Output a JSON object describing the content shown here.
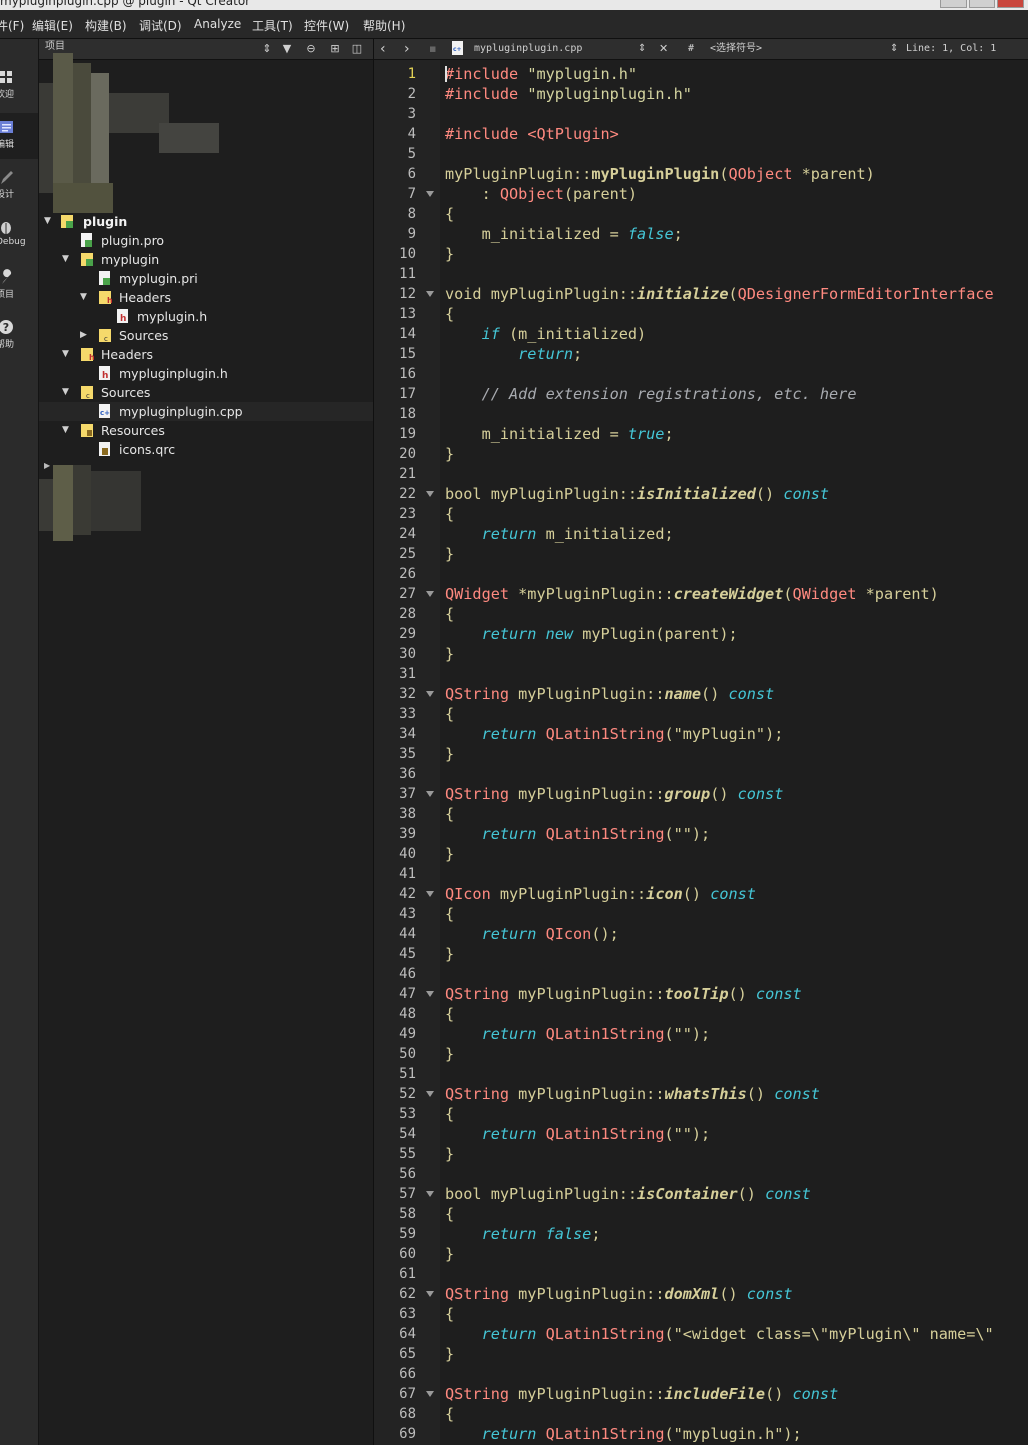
{
  "window": {
    "title": "mypluginplugin.cpp @ plugin - Qt Creator"
  },
  "menu": [
    {
      "id": "file",
      "label": "件(F)"
    },
    {
      "id": "edit",
      "label": "编辑(E)"
    },
    {
      "id": "build",
      "label": "构建(B)"
    },
    {
      "id": "debug",
      "label": "调试(D)"
    },
    {
      "id": "analyze",
      "label": "Analyze"
    },
    {
      "id": "tools",
      "label": "工具(T)"
    },
    {
      "id": "controls",
      "label": "控件(W)"
    },
    {
      "id": "help",
      "label": "帮助(H)"
    }
  ],
  "modes": [
    {
      "id": "welcome",
      "label": "欢迎",
      "icon": "grid-icon"
    },
    {
      "id": "edit",
      "label": "编辑",
      "icon": "edit-doc-icon",
      "active": true
    },
    {
      "id": "design",
      "label": "设计",
      "icon": "pencil-icon"
    },
    {
      "id": "debug",
      "label": "Debug",
      "icon": "bug-icon"
    },
    {
      "id": "projects",
      "label": "项目",
      "icon": "wrench-icon"
    },
    {
      "id": "help",
      "label": "帮助",
      "icon": "help-icon"
    }
  ],
  "sidebar": {
    "view_label": "项目",
    "tree": [
      {
        "label": "plugin",
        "icon": "project-icon",
        "arrow": "open",
        "bold": true
      },
      {
        "label": "plugin.pro",
        "icon": "pro-file-icon"
      },
      {
        "label": "myplugin",
        "icon": "project-icon",
        "arrow": "open"
      },
      {
        "label": "myplugin.pri",
        "icon": "pro-file-icon"
      },
      {
        "label": "Headers",
        "icon": "header-folder-icon",
        "arrow": "open"
      },
      {
        "label": "myplugin.h",
        "icon": "header-file-icon"
      },
      {
        "label": "Sources",
        "icon": "source-folder-icon",
        "arrow": "closed"
      },
      {
        "label": "Headers",
        "icon": "header-folder-icon",
        "arrow": "open"
      },
      {
        "label": "mypluginplugin.h",
        "icon": "header-file-icon"
      },
      {
        "label": "Sources",
        "icon": "source-folder-icon",
        "arrow": "open"
      },
      {
        "label": "mypluginplugin.cpp",
        "icon": "cpp-file-icon",
        "selected": true
      },
      {
        "label": "Resources",
        "icon": "resource-folder-icon",
        "arrow": "open"
      },
      {
        "label": "icons.qrc",
        "icon": "qrc-file-icon"
      }
    ]
  },
  "editor": {
    "file_name": "mypluginplugin.cpp",
    "hash_label": "#",
    "symbol_selector": "<选择符号>",
    "cursor_pos": "Line: 1, Col: 1",
    "current_line": 1,
    "line_numbers": [
      "1",
      "2",
      "3",
      "4",
      "5",
      "6",
      "7",
      "8",
      "9",
      "10",
      "11",
      "12",
      "13",
      "14",
      "15",
      "16",
      "17",
      "18",
      "19",
      "20",
      "21",
      "22",
      "23",
      "24",
      "25",
      "26",
      "27",
      "28",
      "29",
      "30",
      "31",
      "32",
      "33",
      "34",
      "35",
      "36",
      "37",
      "38",
      "39",
      "40",
      "41",
      "42",
      "43",
      "44",
      "45",
      "46",
      "47",
      "48",
      "49",
      "50",
      "51",
      "52",
      "53",
      "54",
      "55",
      "56",
      "57",
      "58",
      "59",
      "60",
      "61",
      "62",
      "63",
      "64",
      "65",
      "66",
      "67",
      "68",
      "69"
    ],
    "fold_lines": [
      7,
      12,
      22,
      27,
      32,
      37,
      42,
      47,
      52,
      57,
      62,
      67
    ],
    "lines": [
      [
        [
          "pp",
          "#include"
        ],
        [
          "pl",
          " "
        ],
        [
          "str",
          "\"myplugin.h\""
        ]
      ],
      [
        [
          "pp",
          "#include"
        ],
        [
          "pl",
          " "
        ],
        [
          "str",
          "\"mypluginplugin.h\""
        ]
      ],
      [],
      [
        [
          "pp",
          "#include"
        ],
        [
          "pl",
          " "
        ],
        [
          "pp",
          "<QtPlugin>"
        ]
      ],
      [],
      [
        [
          "pl",
          "myPluginPlugin::"
        ],
        [
          "bolda",
          "myPluginPlugin"
        ],
        [
          "pl",
          "("
        ],
        [
          "type",
          "QObject"
        ],
        [
          "pl",
          " *parent)"
        ]
      ],
      [
        [
          "pl",
          "    : "
        ],
        [
          "type",
          "QObject"
        ],
        [
          "pl",
          "(parent)"
        ]
      ],
      [
        [
          "pl",
          "{"
        ]
      ],
      [
        [
          "pl",
          "    m_initialized = "
        ],
        [
          "it",
          "false"
        ],
        [
          "pl",
          ";"
        ]
      ],
      [
        [
          "pl",
          "}"
        ]
      ],
      [],
      [
        [
          "pl",
          "void myPluginPlugin::"
        ],
        [
          "bold",
          "initialize"
        ],
        [
          "pl",
          "("
        ],
        [
          "type",
          "QDesignerFormEditorInterface"
        ]
      ],
      [
        [
          "pl",
          "{"
        ]
      ],
      [
        [
          "pl",
          "    "
        ],
        [
          "ctl",
          "if"
        ],
        [
          "pl",
          " (m_initialized)"
        ]
      ],
      [
        [
          "pl",
          "        "
        ],
        [
          "ctl",
          "return"
        ],
        [
          "pl",
          ";"
        ]
      ],
      [],
      [
        [
          "cm",
          "    // Add extension registrations, etc. here"
        ]
      ],
      [],
      [
        [
          "pl",
          "    m_initialized = "
        ],
        [
          "it",
          "true"
        ],
        [
          "pl",
          ";"
        ]
      ],
      [
        [
          "pl",
          "}"
        ]
      ],
      [],
      [
        [
          "pl",
          "bool myPluginPlugin::"
        ],
        [
          "bold",
          "isInitialized"
        ],
        [
          "pl",
          "() "
        ],
        [
          "it",
          "const"
        ]
      ],
      [
        [
          "pl",
          "{"
        ]
      ],
      [
        [
          "pl",
          "    "
        ],
        [
          "ctl",
          "return"
        ],
        [
          "pl",
          " m_initialized;"
        ]
      ],
      [
        [
          "pl",
          "}"
        ]
      ],
      [],
      [
        [
          "type",
          "QWidget"
        ],
        [
          "pl",
          " *myPluginPlugin::"
        ],
        [
          "bold",
          "createWidget"
        ],
        [
          "pl",
          "("
        ],
        [
          "type",
          "QWidget"
        ],
        [
          "pl",
          " *parent)"
        ]
      ],
      [
        [
          "pl",
          "{"
        ]
      ],
      [
        [
          "pl",
          "    "
        ],
        [
          "ctl",
          "return"
        ],
        [
          "pl",
          " "
        ],
        [
          "it",
          "new"
        ],
        [
          "pl",
          " myPlugin(parent);"
        ]
      ],
      [
        [
          "pl",
          "}"
        ]
      ],
      [],
      [
        [
          "type",
          "QString"
        ],
        [
          "pl",
          " myPluginPlugin::"
        ],
        [
          "bold",
          "name"
        ],
        [
          "pl",
          "() "
        ],
        [
          "it",
          "const"
        ]
      ],
      [
        [
          "pl",
          "{"
        ]
      ],
      [
        [
          "pl",
          "    "
        ],
        [
          "ctl",
          "return"
        ],
        [
          "pl",
          " "
        ],
        [
          "type",
          "QLatin1String"
        ],
        [
          "pl",
          "(\"myPlugin\");"
        ]
      ],
      [
        [
          "pl",
          "}"
        ]
      ],
      [],
      [
        [
          "type",
          "QString"
        ],
        [
          "pl",
          " myPluginPlugin::"
        ],
        [
          "bold",
          "group"
        ],
        [
          "pl",
          "() "
        ],
        [
          "it",
          "const"
        ]
      ],
      [
        [
          "pl",
          "{"
        ]
      ],
      [
        [
          "pl",
          "    "
        ],
        [
          "ctl",
          "return"
        ],
        [
          "pl",
          " "
        ],
        [
          "type",
          "QLatin1String"
        ],
        [
          "pl",
          "(\"\");"
        ]
      ],
      [
        [
          "pl",
          "}"
        ]
      ],
      [],
      [
        [
          "type",
          "QIcon"
        ],
        [
          "pl",
          " myPluginPlugin::"
        ],
        [
          "bold",
          "icon"
        ],
        [
          "pl",
          "() "
        ],
        [
          "it",
          "const"
        ]
      ],
      [
        [
          "pl",
          "{"
        ]
      ],
      [
        [
          "pl",
          "    "
        ],
        [
          "ctl",
          "return"
        ],
        [
          "pl",
          " "
        ],
        [
          "type",
          "QIcon"
        ],
        [
          "pl",
          "();"
        ]
      ],
      [
        [
          "pl",
          "}"
        ]
      ],
      [],
      [
        [
          "type",
          "QString"
        ],
        [
          "pl",
          " myPluginPlugin::"
        ],
        [
          "bold",
          "toolTip"
        ],
        [
          "pl",
          "() "
        ],
        [
          "it",
          "const"
        ]
      ],
      [
        [
          "pl",
          "{"
        ]
      ],
      [
        [
          "pl",
          "    "
        ],
        [
          "ctl",
          "return"
        ],
        [
          "pl",
          " "
        ],
        [
          "type",
          "QLatin1String"
        ],
        [
          "pl",
          "(\"\");"
        ]
      ],
      [
        [
          "pl",
          "}"
        ]
      ],
      [],
      [
        [
          "type",
          "QString"
        ],
        [
          "pl",
          " myPluginPlugin::"
        ],
        [
          "bold",
          "whatsThis"
        ],
        [
          "pl",
          "() "
        ],
        [
          "it",
          "const"
        ]
      ],
      [
        [
          "pl",
          "{"
        ]
      ],
      [
        [
          "pl",
          "    "
        ],
        [
          "ctl",
          "return"
        ],
        [
          "pl",
          " "
        ],
        [
          "type",
          "QLatin1String"
        ],
        [
          "pl",
          "(\"\");"
        ]
      ],
      [
        [
          "pl",
          "}"
        ]
      ],
      [],
      [
        [
          "pl",
          "bool myPluginPlugin::"
        ],
        [
          "bold",
          "isContainer"
        ],
        [
          "pl",
          "() "
        ],
        [
          "it",
          "const"
        ]
      ],
      [
        [
          "pl",
          "{"
        ]
      ],
      [
        [
          "pl",
          "    "
        ],
        [
          "ctl",
          "return"
        ],
        [
          "pl",
          " "
        ],
        [
          "it",
          "false"
        ],
        [
          "pl",
          ";"
        ]
      ],
      [
        [
          "pl",
          "}"
        ]
      ],
      [],
      [
        [
          "type",
          "QString"
        ],
        [
          "pl",
          " myPluginPlugin::"
        ],
        [
          "bold",
          "domXml"
        ],
        [
          "pl",
          "() "
        ],
        [
          "it",
          "const"
        ]
      ],
      [
        [
          "pl",
          "{"
        ]
      ],
      [
        [
          "pl",
          "    "
        ],
        [
          "ctl",
          "return"
        ],
        [
          "pl",
          " "
        ],
        [
          "type",
          "QLatin1String"
        ],
        [
          "pl",
          "(\"<widget class=\\\"myPlugin\\\" name=\\\""
        ]
      ],
      [
        [
          "pl",
          "}"
        ]
      ],
      [],
      [
        [
          "type",
          "QString"
        ],
        [
          "pl",
          " myPluginPlugin::"
        ],
        [
          "bold",
          "includeFile"
        ],
        [
          "pl",
          "() "
        ],
        [
          "it",
          "const"
        ]
      ],
      [
        [
          "pl",
          "{"
        ]
      ],
      [
        [
          "pl",
          "    "
        ],
        [
          "ctl",
          "return"
        ],
        [
          "pl",
          " "
        ],
        [
          "type",
          "QLatin1String"
        ],
        [
          "pl",
          "(\"myplugin.h\");"
        ]
      ]
    ]
  },
  "colors": {
    "editor_bg": "#1e1e1e",
    "gutter_bg": "#232323",
    "preprocessor": "#ff8a80",
    "keyword": "#45c6d6",
    "text": "#d6cf9a",
    "comment": "#a8abb0",
    "current_line_number": "#e3d256"
  }
}
